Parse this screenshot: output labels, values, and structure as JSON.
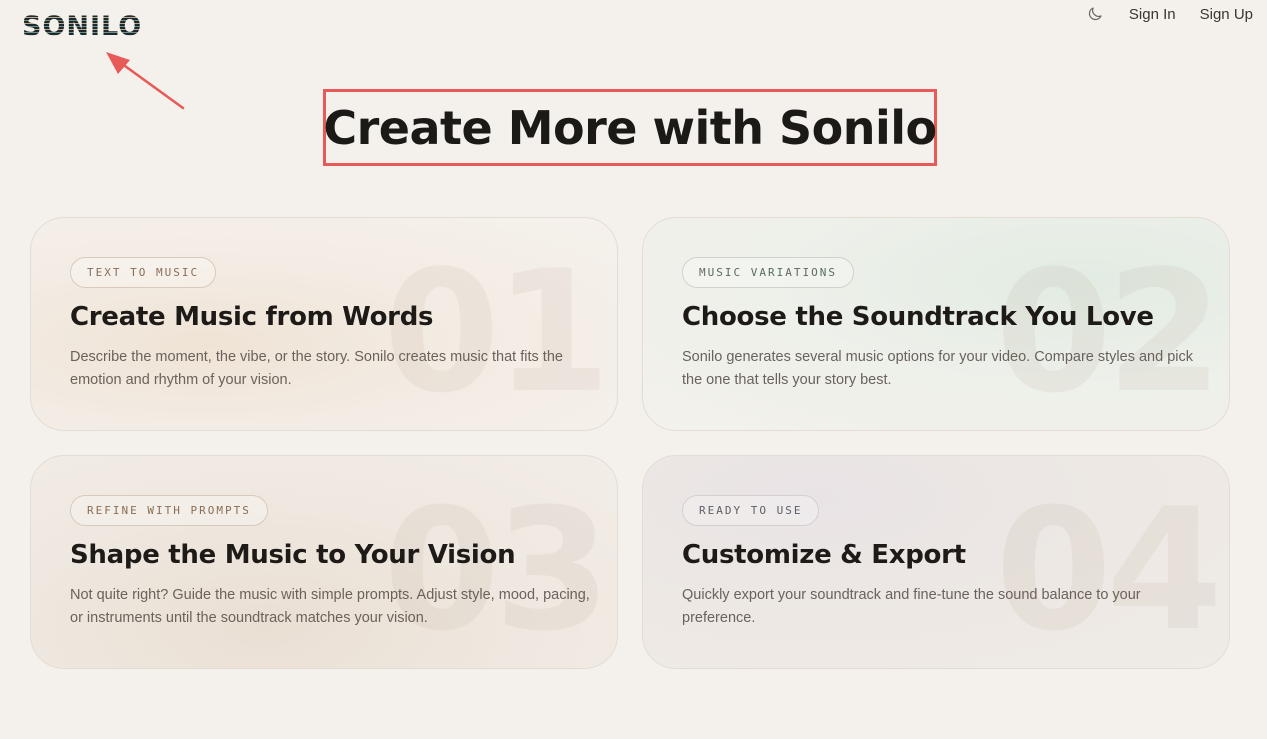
{
  "header": {
    "logo": "SONILO",
    "nav": {
      "theme_icon": "moon-icon",
      "sign_in": "Sign In",
      "sign_up": "Sign Up"
    }
  },
  "hero": {
    "title": "Create More with Sonilo"
  },
  "annotations": {
    "color": "#e85a58"
  },
  "cards": [
    {
      "number": "01",
      "tag": "TEXT TO MUSIC",
      "title": "Create Music from Words",
      "description": "Describe the moment, the vibe, or the story. Sonilo creates music that fits the emotion and rhythm of your vision."
    },
    {
      "number": "02",
      "tag": "MUSIC VARIATIONS",
      "title": "Choose the Soundtrack You Love",
      "description": "Sonilo generates several music options for your video. Compare styles and pick the one that tells your story best."
    },
    {
      "number": "03",
      "tag": "REFINE WITH PROMPTS",
      "title": "Shape the Music to Your Vision",
      "description": "Not quite right? Guide the music with simple prompts. Adjust style, mood, pacing, or instruments until the soundtrack matches your vision."
    },
    {
      "number": "04",
      "tag": "READY TO USE",
      "title": "Customize & Export",
      "description": "Quickly export your soundtrack and fine-tune the sound balance to your preference."
    }
  ]
}
